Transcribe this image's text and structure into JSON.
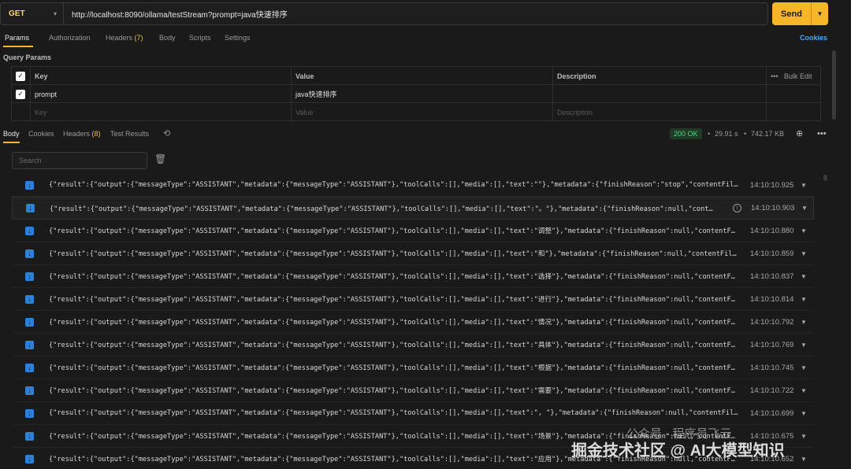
{
  "request": {
    "method": "GET",
    "url": "http://localhost:8090/ollama/testStream?prompt=java快速排序",
    "send_label": "Send"
  },
  "tabs": {
    "params": "Params",
    "authorization": "Authorization",
    "headers": "Headers",
    "headers_count": "(7)",
    "body": "Body",
    "scripts": "Scripts",
    "settings": "Settings",
    "cookies": "Cookies"
  },
  "query_params": {
    "title": "Query Params",
    "col_key": "Key",
    "col_value": "Value",
    "col_desc": "Description",
    "bulk_edit": "Bulk Edit",
    "row_key": "prompt",
    "row_value": "java快速排序",
    "ph_key": "Key",
    "ph_value": "Value",
    "ph_desc": "Description"
  },
  "response": {
    "tab_body": "Body",
    "tab_cookies": "Cookies",
    "tab_headers": "Headers",
    "headers_count": "(8)",
    "tab_test": "Test Results",
    "status": "200 OK",
    "time": "29.91 s",
    "size": "742.17 KB",
    "search_placeholder": "Search"
  },
  "messages": [
    {
      "text": "{\"result\":{\"output\":{\"messageType\":\"ASSISTANT\",\"metadata\":{\"messageType\":\"ASSISTANT\"},\"toolCalls\":[],\"media\":[],\"text\":\"\"},\"metadata\":{\"finishReason\":\"stop\",\"contentFil...",
      "time": "14:10:10.925"
    },
    {
      "text": "{\"result\":{\"output\":{\"messageType\":\"ASSISTANT\",\"metadata\":{\"messageType\":\"ASSISTANT\"},\"toolCalls\":[],\"media\":[],\"text\":\"。\"},\"metadata\":{\"finishReason\":null,\"conte...",
      "time": "14:10:10.903"
    },
    {
      "text": "{\"result\":{\"output\":{\"messageType\":\"ASSISTANT\",\"metadata\":{\"messageType\":\"ASSISTANT\"},\"toolCalls\":[],\"media\":[],\"text\":\"调整\"},\"metadata\":{\"finishReason\":null,\"contentFi...",
      "time": "14:10:10.880"
    },
    {
      "text": "{\"result\":{\"output\":{\"messageType\":\"ASSISTANT\",\"metadata\":{\"messageType\":\"ASSISTANT\"},\"toolCalls\":[],\"media\":[],\"text\":\"和\"},\"metadata\":{\"finishReason\":null,\"contentFil...",
      "time": "14:10:10.859"
    },
    {
      "text": "{\"result\":{\"output\":{\"messageType\":\"ASSISTANT\",\"metadata\":{\"messageType\":\"ASSISTANT\"},\"toolCalls\":[],\"media\":[],\"text\":\"选择\"},\"metadata\":{\"finishReason\":null,\"contentFi...",
      "time": "14:10:10.837"
    },
    {
      "text": "{\"result\":{\"output\":{\"messageType\":\"ASSISTANT\",\"metadata\":{\"messageType\":\"ASSISTANT\"},\"toolCalls\":[],\"media\":[],\"text\":\"进行\"},\"metadata\":{\"finishReason\":null,\"contentFi...",
      "time": "14:10:10.814"
    },
    {
      "text": "{\"result\":{\"output\":{\"messageType\":\"ASSISTANT\",\"metadata\":{\"messageType\":\"ASSISTANT\"},\"toolCalls\":[],\"media\":[],\"text\":\"情况\"},\"metadata\":{\"finishReason\":null,\"contentFi...",
      "time": "14:10:10.792"
    },
    {
      "text": "{\"result\":{\"output\":{\"messageType\":\"ASSISTANT\",\"metadata\":{\"messageType\":\"ASSISTANT\"},\"toolCalls\":[],\"media\":[],\"text\":\"具体\"},\"metadata\":{\"finishReason\":null,\"contentFi...",
      "time": "14:10:10.769"
    },
    {
      "text": "{\"result\":{\"output\":{\"messageType\":\"ASSISTANT\",\"metadata\":{\"messageType\":\"ASSISTANT\"},\"toolCalls\":[],\"media\":[],\"text\":\"根据\"},\"metadata\":{\"finishReason\":null,\"contentFi...",
      "time": "14:10:10.745"
    },
    {
      "text": "{\"result\":{\"output\":{\"messageType\":\"ASSISTANT\",\"metadata\":{\"messageType\":\"ASSISTANT\"},\"toolCalls\":[],\"media\":[],\"text\":\"需要\"},\"metadata\":{\"finishReason\":null,\"contentFi...",
      "time": "14:10:10.722"
    },
    {
      "text": "{\"result\":{\"output\":{\"messageType\":\"ASSISTANT\",\"metadata\":{\"messageType\":\"ASSISTANT\"},\"toolCalls\":[],\"media\":[],\"text\":\", \"},\"metadata\":{\"finishReason\":null,\"contentFil...",
      "time": "14:10:10.699"
    },
    {
      "text": "{\"result\":{\"output\":{\"messageType\":\"ASSISTANT\",\"metadata\":{\"messageType\":\"ASSISTANT\"},\"toolCalls\":[],\"media\":[],\"text\":\"场景\"},\"metadata\":{\"finishReason\":null,\"contentFi...",
      "time": "14:10:10.675"
    },
    {
      "text": "{\"result\":{\"output\":{\"messageType\":\"ASSISTANT\",\"metadata\":{\"messageType\":\"ASSISTANT\"},\"toolCalls\":[],\"media\":[],\"text\":\"应用\"},\"metadata\":{\"finishReason\":null,\"contentFi...",
      "time": "14:10:10.652"
    }
  ],
  "watermark": {
    "line1": "公众号 · 程序员飞云",
    "line2": "掘金技术社区 @ AI大模型知识"
  }
}
